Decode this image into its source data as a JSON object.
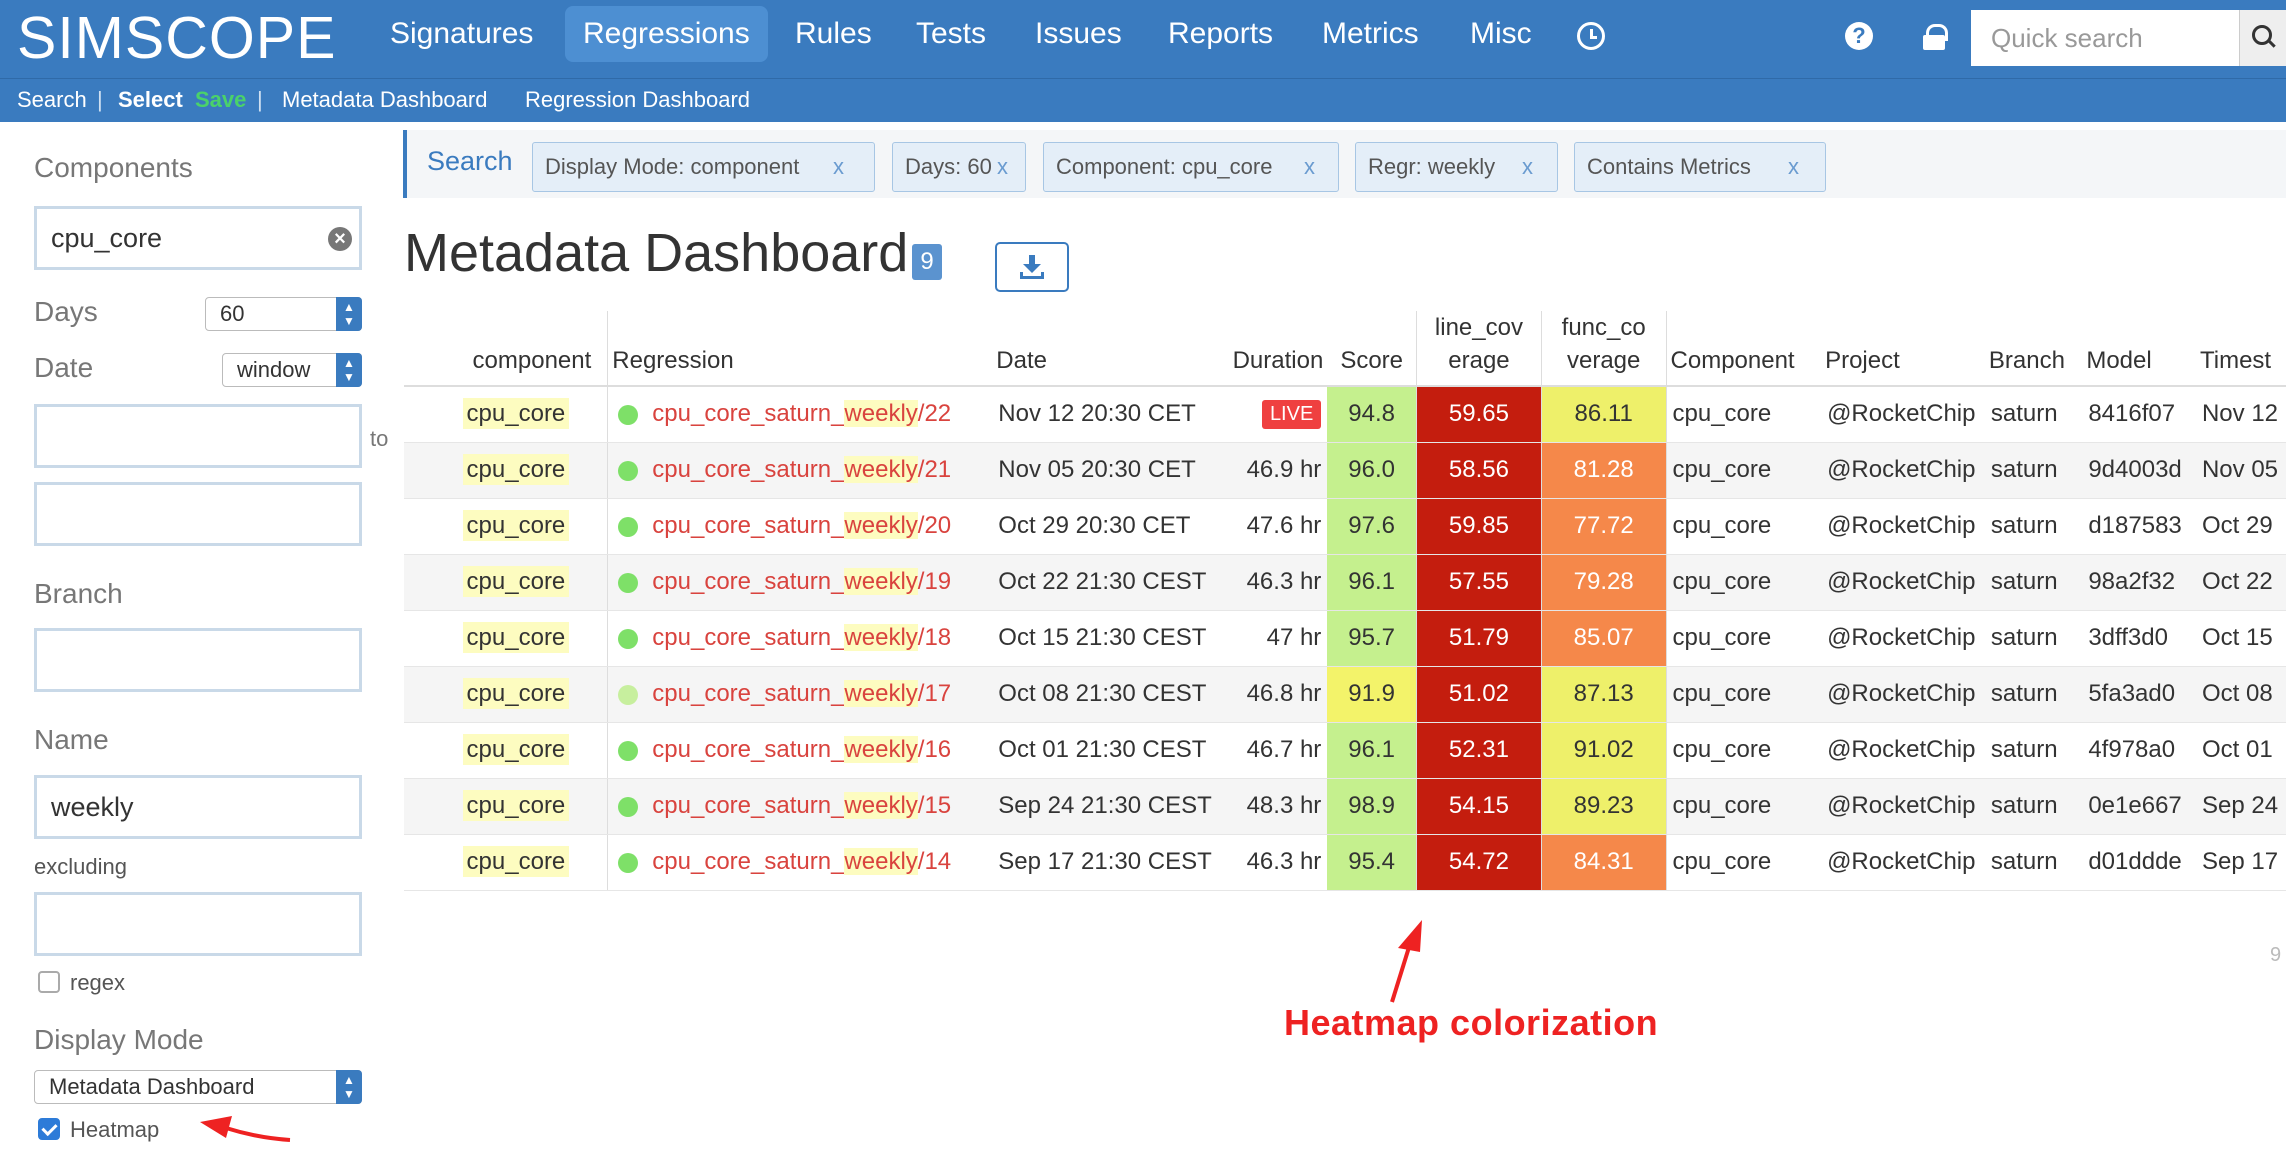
{
  "nav": {
    "logo": "SIMSCOPE",
    "items": [
      "Signatures",
      "Regressions",
      "Rules",
      "Tests",
      "Issues",
      "Reports",
      "Metrics",
      "Misc"
    ],
    "active": "Regressions",
    "help_symbol": "?",
    "search_placeholder": "Quick search"
  },
  "subnav": {
    "search": "Search",
    "sep": "|",
    "select": "Select",
    "save": "Save",
    "metadata_dashboard": "Metadata Dashboard",
    "regression_dashboard": "Regression Dashboard"
  },
  "sidebar": {
    "components_label": "Components",
    "components_value": "cpu_core",
    "clear_symbol": "×",
    "days_label": "Days",
    "days_value": "60",
    "date_label": "Date",
    "date_mode": "window",
    "to_label": "to",
    "branch_label": "Branch",
    "name_label": "Name",
    "name_value": "weekly",
    "excluding_label": "excluding",
    "regex_label": "regex",
    "display_mode_label": "Display Mode",
    "display_mode_value": "Metadata Dashboard",
    "heatmap_label": "Heatmap",
    "heatmap_checked": true,
    "regex_checked": false
  },
  "search_bar": {
    "label": "Search",
    "remove_symbol": "x",
    "chips": [
      {
        "label": "Display Mode:  component"
      },
      {
        "label": "Days:  60"
      },
      {
        "label": "Component:  cpu_core"
      },
      {
        "label": "Regr:  weekly"
      },
      {
        "label": "Contains Metrics"
      }
    ]
  },
  "page": {
    "title": "Metadata Dashboard",
    "count": "9",
    "download_icon": "download-icon"
  },
  "table": {
    "headers": {
      "component": "component",
      "regression": "Regression",
      "date": "Date",
      "duration": "Duration",
      "score": "Score",
      "line_cov_1": "line_cov",
      "line_cov_2": "erage",
      "func_cov_1": "func_co",
      "func_cov_2": "verage",
      "component2": "Component",
      "project": "Project",
      "branch": "Branch",
      "model": "Model",
      "timestamp": "Timest"
    },
    "rows": [
      {
        "component": "cpu_core",
        "reg_prefix": "cpu_core_saturn_",
        "reg_word": "weekly",
        "reg_suffix": "/22",
        "date": "Nov 12 20:30 CET",
        "duration": "LIVE",
        "live": true,
        "score": "94.8",
        "line_cov": "59.65",
        "func_cov": "86.11",
        "component2": "cpu_core",
        "project": "@RocketChip",
        "branch": "saturn",
        "model": "8416f07",
        "timestamp": "Nov 12",
        "status": "green"
      },
      {
        "component": "cpu_core",
        "reg_prefix": "cpu_core_saturn_",
        "reg_word": "weekly",
        "reg_suffix": "/21",
        "date": "Nov 05 20:30 CET",
        "duration": "46.9 hr",
        "live": false,
        "score": "96.0",
        "line_cov": "58.56",
        "func_cov": "81.28",
        "component2": "cpu_core",
        "project": "@RocketChip",
        "branch": "saturn",
        "model": "9d4003d",
        "timestamp": "Nov 05",
        "status": "green"
      },
      {
        "component": "cpu_core",
        "reg_prefix": "cpu_core_saturn_",
        "reg_word": "weekly",
        "reg_suffix": "/20",
        "date": "Oct 29 20:30 CET",
        "duration": "47.6 hr",
        "live": false,
        "score": "97.6",
        "line_cov": "59.85",
        "func_cov": "77.72",
        "component2": "cpu_core",
        "project": "@RocketChip",
        "branch": "saturn",
        "model": "d187583",
        "timestamp": "Oct 29",
        "status": "green"
      },
      {
        "component": "cpu_core",
        "reg_prefix": "cpu_core_saturn_",
        "reg_word": "weekly",
        "reg_suffix": "/19",
        "date": "Oct 22 21:30 CEST",
        "duration": "46.3 hr",
        "live": false,
        "score": "96.1",
        "line_cov": "57.55",
        "func_cov": "79.28",
        "component2": "cpu_core",
        "project": "@RocketChip",
        "branch": "saturn",
        "model": "98a2f32",
        "timestamp": "Oct 22",
        "status": "green"
      },
      {
        "component": "cpu_core",
        "reg_prefix": "cpu_core_saturn_",
        "reg_word": "weekly",
        "reg_suffix": "/18",
        "date": "Oct 15 21:30 CEST",
        "duration": "47 hr",
        "live": false,
        "score": "95.7",
        "line_cov": "51.79",
        "func_cov": "85.07",
        "component2": "cpu_core",
        "project": "@RocketChip",
        "branch": "saturn",
        "model": "3dff3d0",
        "timestamp": "Oct 15",
        "status": "green"
      },
      {
        "component": "cpu_core",
        "reg_prefix": "cpu_core_saturn_",
        "reg_word": "weekly",
        "reg_suffix": "/17",
        "date": "Oct 08 21:30 CEST",
        "duration": "46.8 hr",
        "live": false,
        "score": "91.9",
        "line_cov": "51.02",
        "func_cov": "87.13",
        "component2": "cpu_core",
        "project": "@RocketChip",
        "branch": "saturn",
        "model": "5fa3ad0",
        "timestamp": "Oct 08",
        "status": "light"
      },
      {
        "component": "cpu_core",
        "reg_prefix": "cpu_core_saturn_",
        "reg_word": "weekly",
        "reg_suffix": "/16",
        "date": "Oct 01 21:30 CEST",
        "duration": "46.7 hr",
        "live": false,
        "score": "96.1",
        "line_cov": "52.31",
        "func_cov": "91.02",
        "component2": "cpu_core",
        "project": "@RocketChip",
        "branch": "saturn",
        "model": "4f978a0",
        "timestamp": "Oct 01",
        "status": "green"
      },
      {
        "component": "cpu_core",
        "reg_prefix": "cpu_core_saturn_",
        "reg_word": "weekly",
        "reg_suffix": "/15",
        "date": "Sep 24 21:30 CEST",
        "duration": "48.3 hr",
        "live": false,
        "score": "98.9",
        "line_cov": "54.15",
        "func_cov": "89.23",
        "component2": "cpu_core",
        "project": "@RocketChip",
        "branch": "saturn",
        "model": "0e1e667",
        "timestamp": "Sep 24",
        "status": "green"
      },
      {
        "component": "cpu_core",
        "reg_prefix": "cpu_core_saturn_",
        "reg_word": "weekly",
        "reg_suffix": "/14",
        "date": "Sep 17 21:30 CEST",
        "duration": "46.3 hr",
        "live": false,
        "score": "95.4",
        "line_cov": "54.72",
        "func_cov": "84.31",
        "component2": "cpu_core",
        "project": "@RocketChip",
        "branch": "saturn",
        "model": "d01ddde",
        "timestamp": "Sep 17",
        "status": "green"
      }
    ]
  },
  "heatmap_colors": {
    "score_high": "#c5f08e",
    "score_mid": "#f3f36a",
    "line_cov": "#c41d0e",
    "func_cov_high": "#eef06a",
    "func_cov_low": "#f5884a"
  },
  "annotation": {
    "text": "Heatmap colorization",
    "color": "#ee2222"
  },
  "footer": {
    "page_number": "9"
  }
}
